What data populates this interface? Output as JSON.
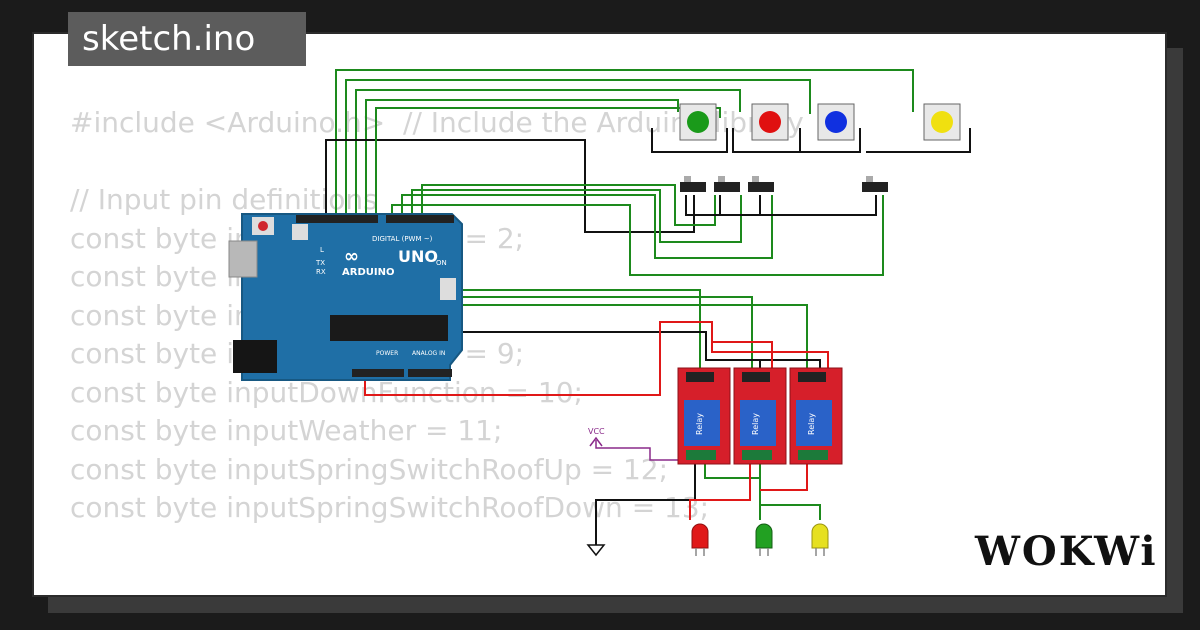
{
  "title": "sketch.ino",
  "logo": "WOKWi",
  "code_lines": [
    "#include <Arduino.h>  // Include the Arduino library",
    "",
    "// Input pin definitions",
    "const byte inputUpFunction = 2;",
    "const byte input",
    "const byte input",
    "const byte inputUpFunction = 9;",
    "const byte inputDownFunction = 10;",
    "const byte inputWeather = 11;",
    "const byte inputSpringSwitchRoofUp = 12;",
    "const byte inputSpringSwitchRoofDown = 13;"
  ],
  "board": {
    "brand": "ARDUINO",
    "model": "UNO",
    "digital_label": "DIGITAL (PWM ~)",
    "analog_label": "ANALOG IN",
    "power_label": "POWER",
    "on_label": "ON",
    "tx_label": "TX",
    "rx_label": "RX",
    "l_label": "L"
  },
  "buttons": [
    {
      "color": "#1a9a1a"
    },
    {
      "color": "#e01010"
    },
    {
      "color": "#1030e0"
    },
    {
      "color": "#f0e010"
    }
  ],
  "switch_count": 4,
  "relays": [
    {
      "label": "Relay"
    },
    {
      "label": "Relay"
    },
    {
      "label": "Relay"
    }
  ],
  "leds": [
    {
      "color": "#e01818"
    },
    {
      "color": "#22a022"
    },
    {
      "color": "#e6e020"
    }
  ],
  "vcc_label": "VCC",
  "wire_colors": {
    "green": "#1d8a1d",
    "black": "#111111",
    "red": "#e01818"
  }
}
